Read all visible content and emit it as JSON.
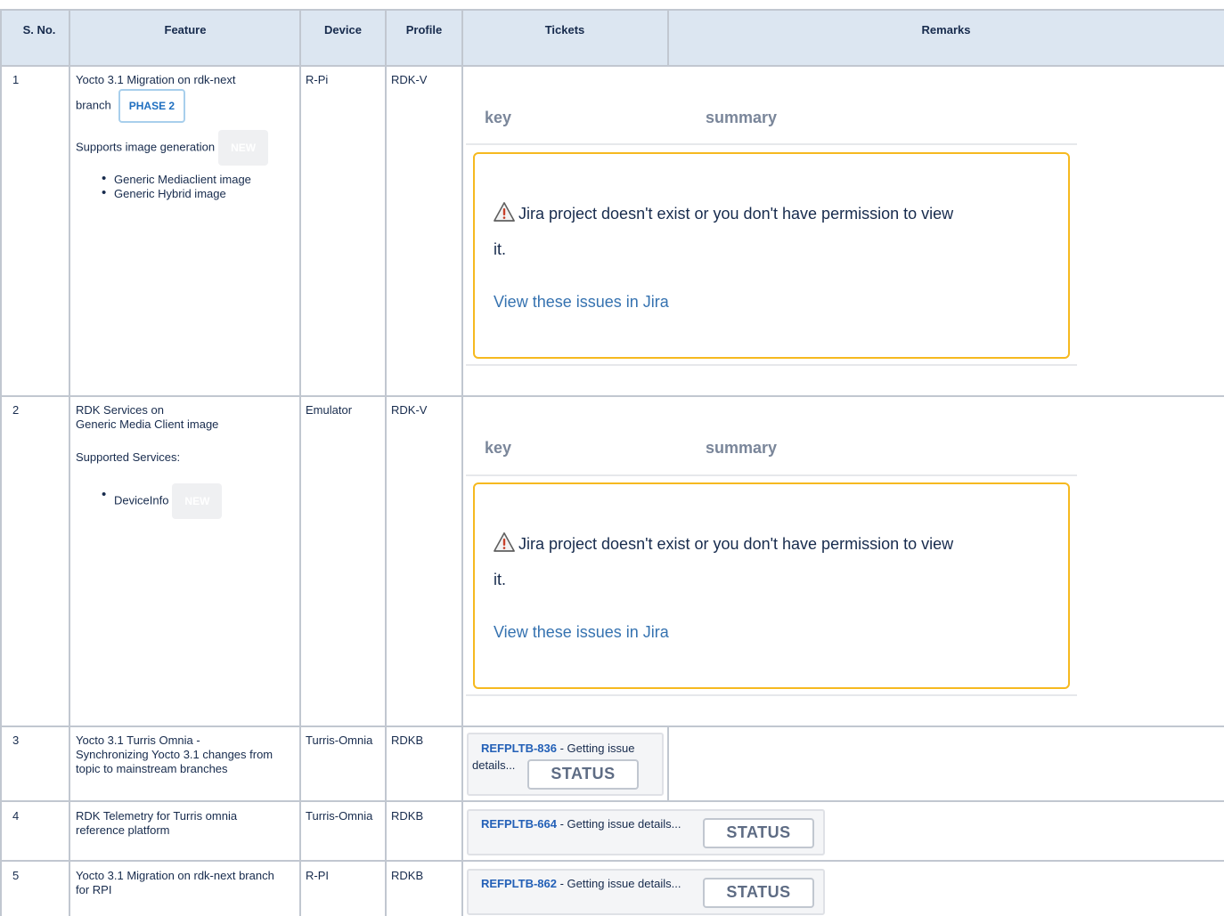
{
  "headers": {
    "sno": "S. No.",
    "feature": "Feature",
    "device": "Device",
    "profile": "Profile",
    "tickets": "Tickets",
    "remarks": "Remarks"
  },
  "jira": {
    "col_key": "key",
    "col_summary": "summary",
    "error_line1": "Jira project doesn't exist or you don't have permission to view",
    "error_line2": "it.",
    "view_link": "View these issues in Jira",
    "warning_icon": "warning-triangle-icon"
  },
  "rows": [
    {
      "no": "1",
      "feature_line1": "Yocto 3.1 Migration on rdk-next",
      "feature_line2": "branch",
      "lozenge": "PHASE 2",
      "supports": "Supports image generation",
      "new_badge": "NEW",
      "bullets": [
        "Generic Mediaclient image",
        "Generic Hybrid image"
      ],
      "device": "R-Pi",
      "profile": "RDK-V"
    },
    {
      "no": "2",
      "feature_line1": "RDK Services on",
      "feature_line2": "Generic Media Client image",
      "supports": "Supported Services:",
      "bullets": [
        "DeviceInfo"
      ],
      "new_badge": "NEW",
      "device": "Emulator",
      "profile": "RDK-V"
    },
    {
      "no": "3",
      "feature_lines": [
        "Yocto 3.1 Turris Omnia -",
        "Synchronizing Yocto 3.1 changes from",
        "topic to mainstream branches"
      ],
      "device": "Turris-Omnia",
      "profile": "RDKB",
      "ticket_key": "REFPLTB-836",
      "ticket_text_a": " - Getting issue",
      "ticket_text_b": "details...",
      "status": "STATUS"
    },
    {
      "no": "4",
      "feature_lines": [
        "RDK Telemetry for Turris omnia",
        "reference platform"
      ],
      "device": "Turris-Omnia",
      "profile": "RDKB",
      "ticket_key": "REFPLTB-664",
      "ticket_text": " - Getting issue details...",
      "status": "STATUS"
    },
    {
      "no": "5",
      "feature_lines": [
        "Yocto 3.1 Migration on rdk-next branch",
        "for RPI"
      ],
      "device": "R-PI",
      "profile": "RDKB",
      "ticket_key": "REFPLTB-862",
      "ticket_text": " - Getting issue details...",
      "status": "STATUS"
    }
  ]
}
